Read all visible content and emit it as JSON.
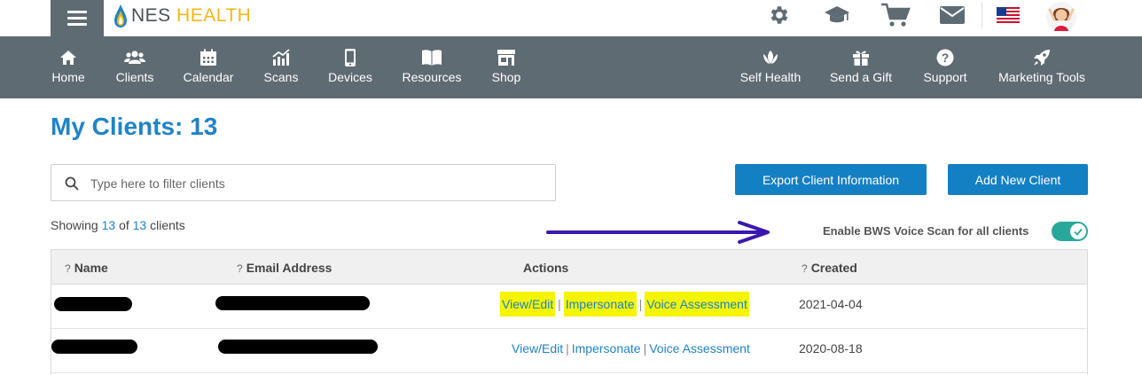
{
  "brand": {
    "name_part1": "NES",
    "name_part2": "HEALTH"
  },
  "top_icons": [
    "gear-icon",
    "graduation-cap-icon",
    "cart-icon",
    "mail-icon",
    "us-flag-icon",
    "user-avatar"
  ],
  "nav": {
    "left": [
      {
        "label": "Home",
        "icon": "home-icon"
      },
      {
        "label": "Clients",
        "icon": "users-icon"
      },
      {
        "label": "Calendar",
        "icon": "calendar-icon"
      },
      {
        "label": "Scans",
        "icon": "chart-icon"
      },
      {
        "label": "Devices",
        "icon": "mobile-icon"
      },
      {
        "label": "Resources",
        "icon": "book-icon"
      },
      {
        "label": "Shop",
        "icon": "store-icon"
      }
    ],
    "right": [
      {
        "label": "Self Health",
        "icon": "lotus-icon"
      },
      {
        "label": "Send a Gift",
        "icon": "gift-icon"
      },
      {
        "label": "Support",
        "icon": "question-icon"
      },
      {
        "label": "Marketing Tools",
        "icon": "rocket-icon"
      }
    ]
  },
  "page": {
    "title": "My Clients: 13",
    "search_placeholder": "Type here to filter clients",
    "export_button": "Export Client Information",
    "add_button": "Add New Client",
    "showing_prefix": "Showing",
    "showing_count": "13",
    "showing_of": "of",
    "showing_total": "13",
    "showing_suffix": "clients",
    "bws_label": "Enable BWS Voice Scan for all clients",
    "bws_enabled": true
  },
  "table": {
    "headers": {
      "help": "?",
      "name": "Name",
      "email": "Email Address",
      "actions": "Actions",
      "created": "Created"
    },
    "rows": [
      {
        "view": "View/Edit",
        "impersonate": "Impersonate",
        "voice": "Voice Assessment",
        "sep": "|",
        "created": "2021-04-04",
        "highlighted": true
      },
      {
        "view": "View/Edit",
        "impersonate": "Impersonate",
        "voice": "Voice Assessment",
        "sep": "|",
        "created": "2020-08-18",
        "highlighted": false
      }
    ]
  },
  "colors": {
    "nav_bg": "#5f6b73",
    "primary": "#1480c4",
    "title": "#1f84c6",
    "toggle": "#28a89a",
    "highlight": "#f5f500",
    "arrow": "#3a17b0"
  }
}
